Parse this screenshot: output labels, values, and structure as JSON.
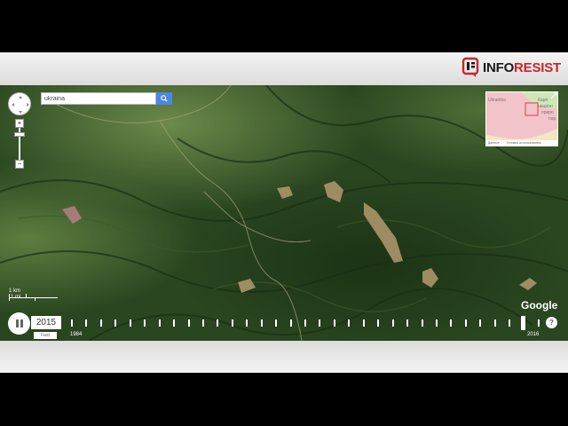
{
  "brand": {
    "logo_left": "INFO",
    "logo_right": "RESIST",
    "accent_color": "#c8262c"
  },
  "map": {
    "type": "satellite-timelapse",
    "search": {
      "value": "ukraina",
      "icon": "search-icon"
    },
    "minimap": {
      "labels": [
        "Ukrainka",
        "Карп",
        "национ",
        "приро",
        "пар"
      ],
      "footer": [
        "Данные",
        "Условия использования"
      ]
    },
    "scale": {
      "metric": "1 km",
      "imperial": "1 mi"
    },
    "attribution": "Google",
    "help_label": "?"
  },
  "timelapse": {
    "current_year": "2015",
    "speed_label": "Fast",
    "start_year": "1984",
    "end_year": "2016",
    "progress": 0.97,
    "state": "playing"
  }
}
